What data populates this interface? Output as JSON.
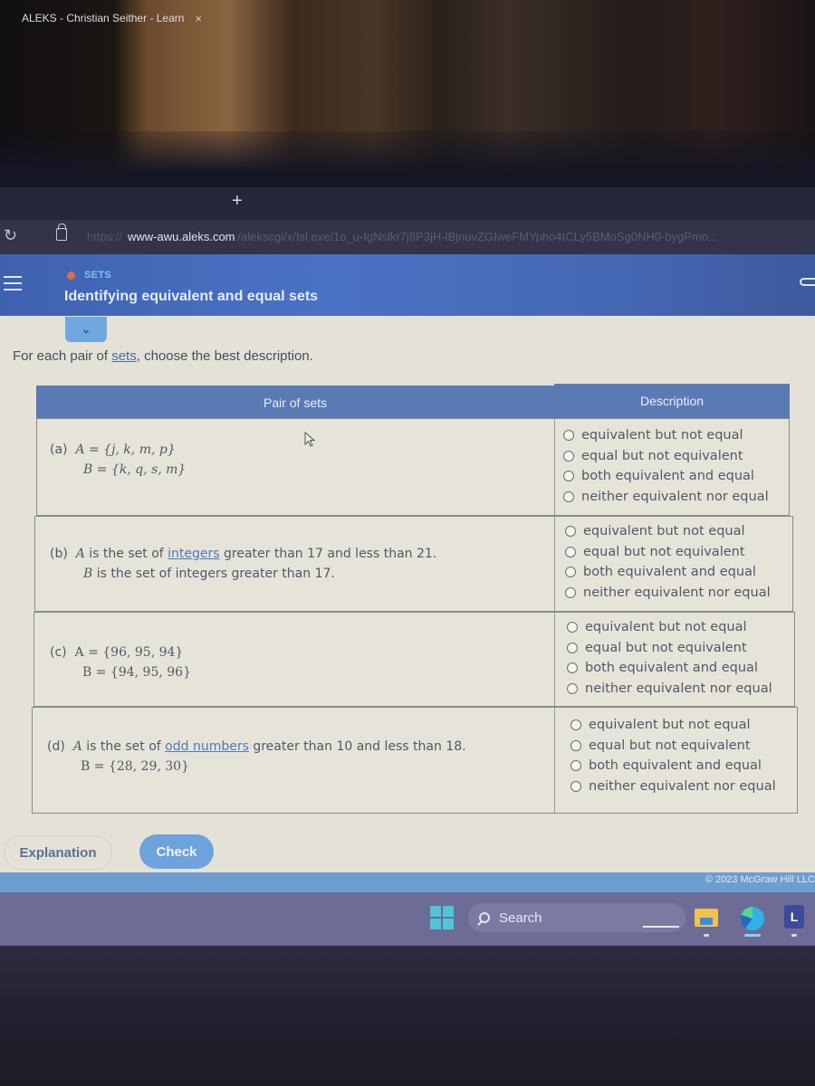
{
  "browser": {
    "tab_title": "ALEKS - Christian Seither - Learn",
    "tab_close": "×",
    "new_tab": "+",
    "url_protocol": "https://",
    "url_host": "www-awu.aleks.com",
    "url_path": "/alekscgi/x/Isl.exe/1o_u-IgNslkr7j8P3jH-lBjnuvZGIweFMYpho4tCLy5BMoSg0NH0-bygPmo..."
  },
  "header": {
    "topic": "SETS",
    "title": "Identifying equivalent and equal sets",
    "collapse_icon": "⌄"
  },
  "instruction": {
    "prefix": "For each pair of ",
    "link": "sets",
    "suffix": ", choose the best description."
  },
  "table": {
    "col_pair": "Pair of sets",
    "col_description": "Description",
    "options": [
      "equivalent but not equal",
      "equal but not equivalent",
      "both equivalent and equal",
      "neither equivalent nor equal"
    ],
    "rows": [
      {
        "label": "(a)",
        "line_a": "A = {j, k, m, p}",
        "line_b": "B = {k, q, s, m}",
        "selected": null
      },
      {
        "label": "(b)",
        "line_a_prefix": "A is the set of ",
        "line_a_link": "integers",
        "line_a_suffix": " greater than 17 and less than 21.",
        "line_b": "B is the set of integers greater than 17.",
        "selected": null
      },
      {
        "label": "(c)",
        "line_a": "A = {96, 95, 94}",
        "line_b": "B = {94, 95, 96}",
        "selected": null
      },
      {
        "label": "(d)",
        "line_a_prefix": "A is the set of ",
        "line_a_link": "odd numbers",
        "line_a_suffix": " greater than 10 and less than 18.",
        "line_b": "B = {28, 29, 30}",
        "selected": null
      }
    ]
  },
  "buttons": {
    "explanation": "Explanation",
    "check": "Check"
  },
  "footer": {
    "copyright": "© 2023 McGraw Hill LLC"
  },
  "taskbar": {
    "search": "Search"
  }
}
